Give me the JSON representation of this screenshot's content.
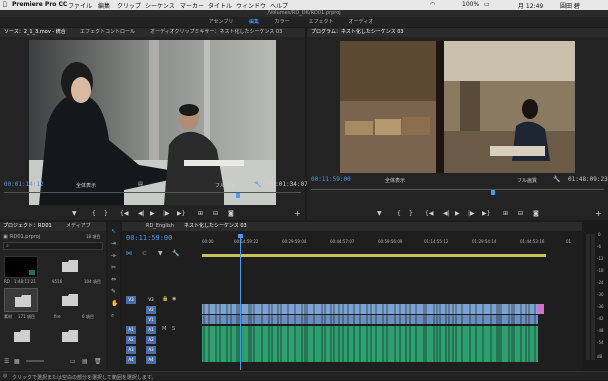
{
  "menubar": {
    "app_name": "Premiere Pro CC",
    "items": [
      "ファイル",
      "編集",
      "クリップ",
      "シーケンス",
      "マーカー",
      "タイトル",
      "ウィンドウ",
      "ヘルプ"
    ],
    "status": {
      "battery": "100%",
      "day_time": "月 12:49",
      "user": "圓田 碧"
    }
  },
  "path": "/Volumes/RD_DK/RD01.prproj",
  "workspaces": [
    "アセンブリ",
    "編集",
    "カラー",
    "エフェクト",
    "オーディオ"
  ],
  "workspace_active": "編集",
  "source": {
    "tabs": [
      "ソース：2_1_3.mov - 統合",
      "エフェクトコントロール",
      "オーディオクリップミキサー：ネスト化したシーケンス 03"
    ],
    "timecode_in": "00:01:14:12",
    "fit": "全体表示",
    "quality": "フル画質",
    "timecode_out": "00:01:34:07"
  },
  "program": {
    "title": "プログラム：ネスト化したシーケンス 03",
    "timecode_in": "00:11:59:00",
    "fit": "全体表示",
    "quality": "フル画質",
    "timecode_out": "01:48:09:23"
  },
  "project": {
    "tabs": [
      "プロジェクト：RD01",
      "メディアブ"
    ],
    "file": "RD01.prproj",
    "count": "18 項目",
    "items": [
      {
        "name": "RD",
        "dur": "1:48:11:21"
      },
      {
        "name": "",
        "dur": "9516"
      },
      {
        "name": "",
        "dur": "104 項目"
      },
      {
        "name": "素材",
        "dur": "171 項目"
      },
      {
        "name": "fire",
        "dur": "6 項目"
      },
      {
        "name": "",
        "dur": ""
      },
      {
        "name": "",
        "dur": ""
      },
      {
        "name": "",
        "dur": ""
      },
      {
        "name": "",
        "dur": ""
      }
    ]
  },
  "timeline": {
    "tabs": [
      "RD_English",
      "ネスト化したシーケンス 03"
    ],
    "timecode": "00:11:59:00",
    "ruler": [
      "00:00",
      "00:14:59:22",
      "00:29:59:04",
      "00:44:57:07",
      "00:59:56:09",
      "01:14:55:12",
      "01:29:54:14",
      "01:44:53:16",
      "01"
    ],
    "tracks": [
      "V3",
      "V2",
      "V1",
      "A1",
      "A2",
      "A3",
      "A4"
    ],
    "db_scale": [
      "0",
      "-6",
      "-12",
      "-18",
      "-24",
      "-30",
      "-36",
      "-42",
      "-48",
      "-54",
      "dB"
    ]
  },
  "status_bar": "クリックで選択または空白の部分を選択して範囲を選択します。",
  "colors": {
    "accent": "#4a9cf0",
    "video_clip": "#7fa3d0",
    "audio_clip": "#2f9e70"
  }
}
